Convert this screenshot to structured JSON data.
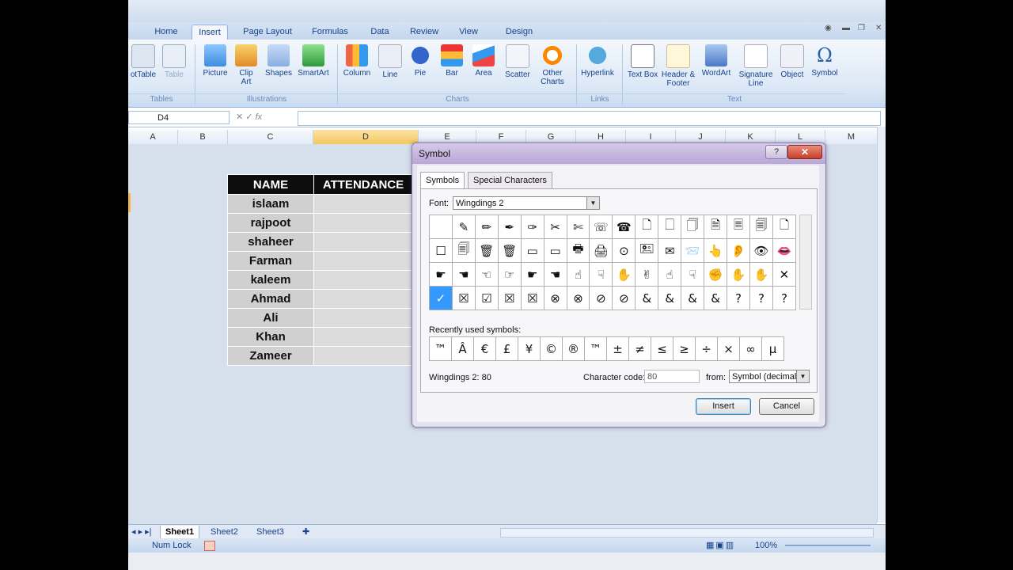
{
  "ribbon_tabs": [
    "Home",
    "Insert",
    "Page Layout",
    "Formulas",
    "Data",
    "Review",
    "View",
    "Design"
  ],
  "active_tab": "Insert",
  "ribbon": {
    "buttons": [
      {
        "label": "otTable",
        "icon": "pivot-table-icon"
      },
      {
        "label": "Table",
        "icon": "table-icon"
      },
      {
        "label": "Picture",
        "icon": "picture-icon"
      },
      {
        "label": "Clip Art",
        "icon": "clip-art-icon"
      },
      {
        "label": "Shapes",
        "icon": "shapes-icon"
      },
      {
        "label": "SmartArt",
        "icon": "smartart-icon"
      },
      {
        "label": "Column",
        "icon": "column-chart-icon"
      },
      {
        "label": "Line",
        "icon": "line-chart-icon"
      },
      {
        "label": "Pie",
        "icon": "pie-chart-icon"
      },
      {
        "label": "Bar",
        "icon": "bar-chart-icon"
      },
      {
        "label": "Area",
        "icon": "area-chart-icon"
      },
      {
        "label": "Scatter",
        "icon": "scatter-chart-icon"
      },
      {
        "label": "Other Charts",
        "icon": "other-charts-icon"
      },
      {
        "label": "Hyperlink",
        "icon": "hyperlink-icon"
      },
      {
        "label": "Text Box",
        "icon": "text-box-icon"
      },
      {
        "label": "Header & Footer",
        "icon": "header-footer-icon"
      },
      {
        "label": "WordArt",
        "icon": "wordart-icon"
      },
      {
        "label": "Signature Line",
        "icon": "signature-line-icon"
      },
      {
        "label": "Object",
        "icon": "object-icon"
      },
      {
        "label": "Symbol",
        "icon": "omega-icon"
      }
    ],
    "groups": [
      "Tables",
      "Illustrations",
      "Charts",
      "Links",
      "Text"
    ]
  },
  "formula_bar": {
    "name_box": "D4",
    "formula": ""
  },
  "columns": [
    "A",
    "B",
    "C",
    "D",
    "E",
    "F",
    "G",
    "H",
    "I",
    "J",
    "K",
    "L",
    "M"
  ],
  "selected_column": "D",
  "table": {
    "headers": [
      "NAME",
      "ATTENDANCE"
    ],
    "names": [
      "islaam",
      "rajpoot",
      "shaheer",
      "Farman",
      "kaleem",
      "Ahmad",
      "Ali",
      "Khan",
      "Zameer"
    ]
  },
  "sheets": [
    "Sheet1",
    "Sheet2",
    "Sheet3"
  ],
  "active_sheet": "Sheet1",
  "status": {
    "num_lock": "Num Lock",
    "zoom": "100%"
  },
  "dialog": {
    "title": "Symbol",
    "help": "?",
    "close": "✕",
    "tabs": [
      "Symbols",
      "Special Characters"
    ],
    "font_label": "Font:",
    "font_value": "Wingdings 2",
    "symbols": [
      [
        "",
        "✎",
        "✏",
        "✒",
        "✑",
        "✂",
        "✄",
        "☏",
        "☎",
        "🗋",
        "🗌",
        "🗍",
        "🗎",
        "🗏",
        "🗐",
        "🗋"
      ],
      [
        "☐",
        "🗐",
        "🗑",
        "🗑",
        "▭",
        "▭",
        "🖶",
        "🖨",
        "⊙",
        "🖭",
        "✉",
        "📨",
        "👆",
        "👂",
        "👁",
        "👄"
      ],
      [
        "☛",
        "☚",
        "☜",
        "☞",
        "☛",
        "☚",
        "☝",
        "☟",
        "✋",
        "✌",
        "☝",
        "☟",
        "✊",
        "✋",
        "✋",
        "✕"
      ],
      [
        "✓",
        "☒",
        "☑",
        "☒",
        "☒",
        "⊗",
        "⊗",
        "⊘",
        "⊘",
        "&",
        "&",
        "&",
        "&",
        "?",
        "?",
        "?"
      ]
    ],
    "selected_symbol": "✓",
    "recent_label": "Recently used symbols:",
    "recent": [
      "™",
      "Â",
      "€",
      "£",
      "¥",
      "©",
      "®",
      "™",
      "±",
      "≠",
      "≤",
      "≥",
      "÷",
      "×",
      "∞",
      "µ"
    ],
    "char_name": "Wingdings 2: 80",
    "char_code_label": "Character code:",
    "char_code": "80",
    "from_label": "from:",
    "from_value": "Symbol (decimal)",
    "insert_label": "Insert",
    "cancel_label": "Cancel"
  }
}
